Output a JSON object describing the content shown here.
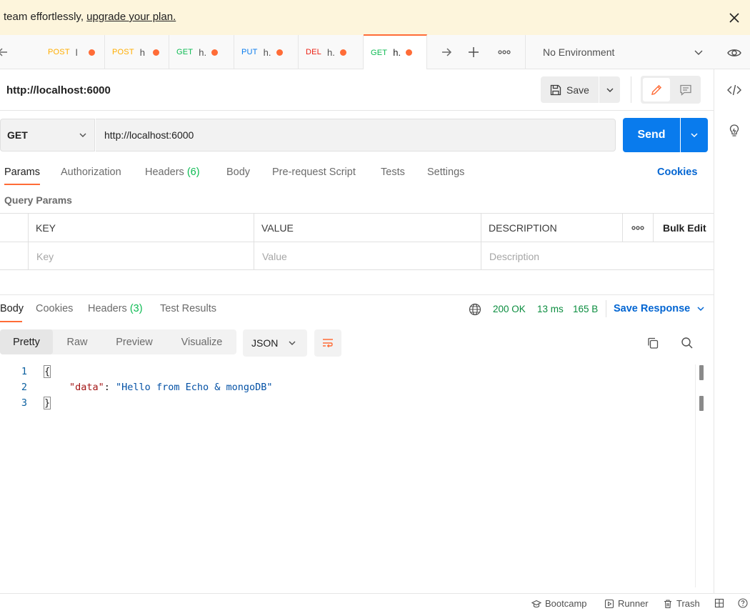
{
  "banner": {
    "text": "team effortlessly, ",
    "link": "upgrade your plan."
  },
  "tabs": [
    {
      "method": "POST",
      "name": "l",
      "method_class": "m-post"
    },
    {
      "method": "POST",
      "name": "h",
      "method_class": "m-post"
    },
    {
      "method": "GET",
      "name": "h.",
      "method_class": "m-get"
    },
    {
      "method": "PUT",
      "name": "h.",
      "method_class": "m-put"
    },
    {
      "method": "DEL",
      "name": "h.",
      "method_class": "m-del"
    },
    {
      "method": "GET",
      "name": "h.",
      "method_class": "m-get",
      "active": true
    }
  ],
  "environment": {
    "label": "No Environment"
  },
  "request": {
    "title": "http://localhost:6000",
    "save_label": "Save",
    "method": "GET",
    "url": "http://localhost:6000",
    "send_label": "Send"
  },
  "request_tabs": {
    "params": "Params",
    "authorization": "Authorization",
    "headers": "Headers",
    "headers_count": "(6)",
    "body": "Body",
    "prerequest": "Pre-request Script",
    "tests": "Tests",
    "settings": "Settings",
    "cookies": "Cookies"
  },
  "query_params": {
    "title": "Query Params",
    "columns": {
      "key": "KEY",
      "value": "VALUE",
      "description": "DESCRIPTION",
      "bulk_edit": "Bulk Edit"
    },
    "placeholders": {
      "key": "Key",
      "value": "Value",
      "description": "Description"
    }
  },
  "response": {
    "tabs": {
      "body": "Body",
      "cookies": "Cookies",
      "headers": "Headers",
      "headers_count": "(3)",
      "test_results": "Test Results"
    },
    "status": "200 OK",
    "time": "13 ms",
    "size": "165 B",
    "save_response": "Save Response",
    "views": {
      "pretty": "Pretty",
      "raw": "Raw",
      "preview": "Preview",
      "visualize": "Visualize"
    },
    "format": "JSON",
    "lines": [
      {
        "n": "1",
        "open": "{"
      },
      {
        "n": "2",
        "key": "\"data\"",
        "sep": ": ",
        "value": "\"Hello from Echo & mongoDB\""
      },
      {
        "n": "3",
        "close": "}"
      }
    ]
  },
  "statusbar": {
    "bootcamp": "Bootcamp",
    "runner": "Runner",
    "trash": "Trash"
  },
  "colors": {
    "accent": "#ff6c37",
    "primary_blue": "#097bed",
    "link_blue": "#0265d2",
    "success_green": "#0b8d3f"
  }
}
